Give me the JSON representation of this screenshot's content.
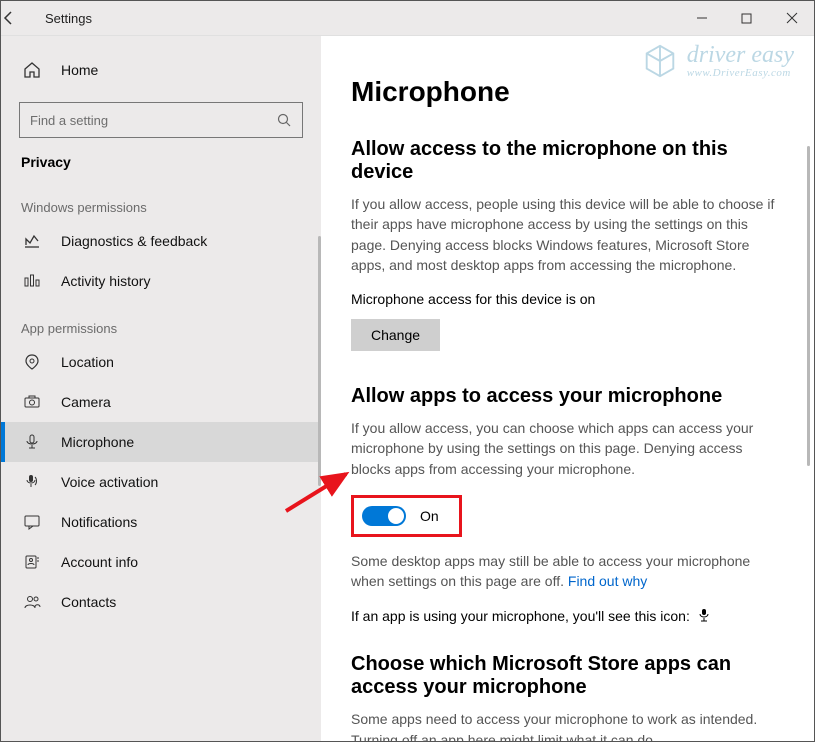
{
  "window": {
    "title": "Settings"
  },
  "sidebar": {
    "home_label": "Home",
    "search_placeholder": "Find a setting",
    "current_category": "Privacy",
    "section_windows": "Windows permissions",
    "section_app": "App permissions",
    "items_windows": [
      {
        "icon": "diagnostics-icon",
        "label": "Diagnostics & feedback"
      },
      {
        "icon": "activity-icon",
        "label": "Activity history"
      }
    ],
    "items_app": [
      {
        "icon": "location-icon",
        "label": "Location"
      },
      {
        "icon": "camera-icon",
        "label": "Camera"
      },
      {
        "icon": "microphone-icon",
        "label": "Microphone",
        "active": true
      },
      {
        "icon": "voice-icon",
        "label": "Voice activation"
      },
      {
        "icon": "notifications-icon",
        "label": "Notifications"
      },
      {
        "icon": "account-icon",
        "label": "Account info"
      },
      {
        "icon": "contacts-icon",
        "label": "Contacts"
      }
    ]
  },
  "main": {
    "page_title": "Microphone",
    "s1_title": "Allow access to the microphone on this device",
    "s1_desc": "If you allow access, people using this device will be able to choose if their apps have microphone access by using the settings on this page. Denying access blocks Windows features, Microsoft Store apps, and most desktop apps from accessing the microphone.",
    "s1_status": "Microphone access for this device is on",
    "change_label": "Change",
    "s2_title": "Allow apps to access your microphone",
    "s2_desc": "If you allow access, you can choose which apps can access your microphone by using the settings on this page. Denying access blocks apps from accessing your microphone.",
    "toggle_label": "On",
    "note_part1": "Some desktop apps may still be able to access your microphone when settings on this page are off. ",
    "note_link": "Find out why",
    "icon_note": "If an app is using your microphone, you'll see this icon:",
    "s3_title": "Choose which Microsoft Store apps can access your microphone",
    "s3_desc": "Some apps need to access your microphone to work as intended. Turning off an app here might limit what it can do."
  },
  "watermark": {
    "name": "driver easy",
    "url": "www.DriverEasy.com"
  }
}
